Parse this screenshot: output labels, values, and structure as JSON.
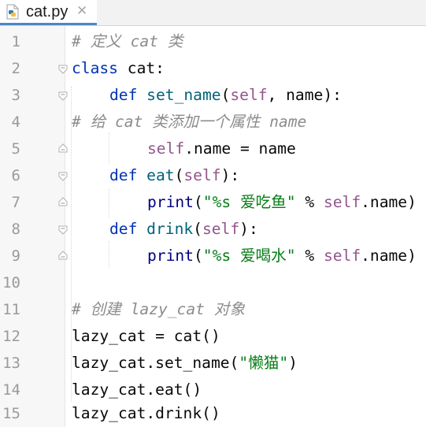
{
  "tab": {
    "filename": "cat.py",
    "file_icon": "python-file-icon",
    "close_icon": "close-icon"
  },
  "colors": {
    "keyword": "#0033b3",
    "self": "#94558d",
    "string": "#067d17",
    "comment": "#8c8c8c",
    "function": "#00627a",
    "builtin": "#000080",
    "line_number": "#9a9a9a",
    "tab_underline": "#4a88c7"
  },
  "editor": {
    "line_numbers": [
      "1",
      "2",
      "3",
      "4",
      "5",
      "6",
      "7",
      "8",
      "9",
      "10",
      "11",
      "12",
      "13",
      "14",
      "15"
    ],
    "lines": [
      {
        "comment": "# 定义 cat 类"
      },
      {
        "kw": "class",
        "rest": " cat:"
      },
      {
        "kw": "def",
        "fn": " set_name",
        "p1": "(",
        "self": "self",
        "rest": ", name):"
      },
      {
        "comment": "# 给 cat 类添加一个属性 name"
      },
      {
        "self": "self",
        "rest": ".name = name"
      },
      {
        "kw": "def",
        "fn": " eat",
        "p1": "(",
        "self": "self",
        "rest": "):"
      },
      {
        "builtin": "print",
        "p1": "(",
        "str": "\"%s 爱吃鱼\"",
        "p2": " % ",
        "self": "self",
        "rest": ".name)"
      },
      {
        "kw": "def",
        "fn": " drink",
        "p1": "(",
        "self": "self",
        "rest": "):"
      },
      {
        "builtin": "print",
        "p1": "(",
        "str": "\"%s 爱喝水\"",
        "p2": " % ",
        "self": "self",
        "rest": ".name)"
      },
      {},
      {
        "comment": "# 创建 lazy_cat 对象"
      },
      {
        "rest": "lazy_cat = cat()"
      },
      {
        "a": "lazy_cat.set_name(",
        "str": "\"懒猫\"",
        "rest": ")"
      },
      {
        "rest": "lazy_cat.eat()"
      },
      {
        "rest": "lazy_cat.drink()"
      }
    ]
  }
}
